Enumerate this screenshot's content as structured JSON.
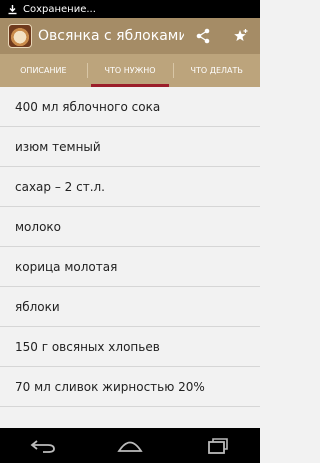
{
  "status_bar": {
    "text": "Сохранение...",
    "icon": "download-icon"
  },
  "action_bar": {
    "title": "Овсянка с яблоками",
    "app_icon": "oatmeal-dish-icon",
    "share_icon": "share-icon",
    "favorite_icon": "star-add-icon"
  },
  "tabs": [
    {
      "label": "ОПИСАНИЕ",
      "active": false
    },
    {
      "label": "ЧТО НУЖНО",
      "active": true
    },
    {
      "label": "ЧТО ДЕЛАТЬ",
      "active": false
    }
  ],
  "ingredients": [
    "400 мл яблочного сока",
    "изюм темный",
    "сахар – 2 ст.л.",
    "молоко",
    "корица молотая",
    "яблоки",
    "150 г овсяных хлопьев",
    "70 мл сливок жирностью 20%"
  ],
  "nav_bar": {
    "back_icon": "back-icon",
    "home_icon": "home-icon",
    "recents_icon": "recents-icon"
  },
  "colors": {
    "action_bar": "#a58c66",
    "tabs": "#bca47c",
    "tab_indicator": "#9b1e2a",
    "list_bg": "#f2f2f2"
  }
}
